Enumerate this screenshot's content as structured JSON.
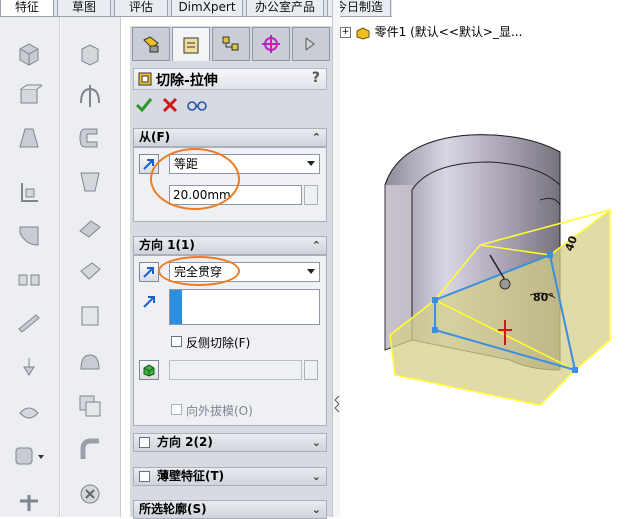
{
  "top_tabs": [
    "特征",
    "草图",
    "评估",
    "DimXpert",
    "办公室产品",
    "今日制造"
  ],
  "property_manager": {
    "title": "切除-拉伸",
    "help": "?",
    "from_group": {
      "label": "从(F)",
      "start_condition": "等距",
      "offset_value": "20.00mm"
    },
    "direction1_group": {
      "label": "方向 1(1)",
      "end_condition": "完全贯穿",
      "flip_side_label": "反侧切除(F)",
      "draft_outward_label": "向外拔模(O)"
    },
    "direction2_label": "方向 2(2)",
    "thin_feature_label": "薄壁特征(T)",
    "selected_contours_label": "所选轮廓(S)"
  },
  "feature_tree": {
    "root_label": "零件1  (默认<<默认>_显..."
  },
  "model": {
    "dim_angle": "80°",
    "dim_side": "40"
  },
  "colors": {
    "accent_blue": "#2a6fd6",
    "annotation_orange": "#f07a20",
    "ok_green": "#2a9a2a",
    "cancel_red": "#d01818",
    "preview_yellow": "#ffff40"
  }
}
